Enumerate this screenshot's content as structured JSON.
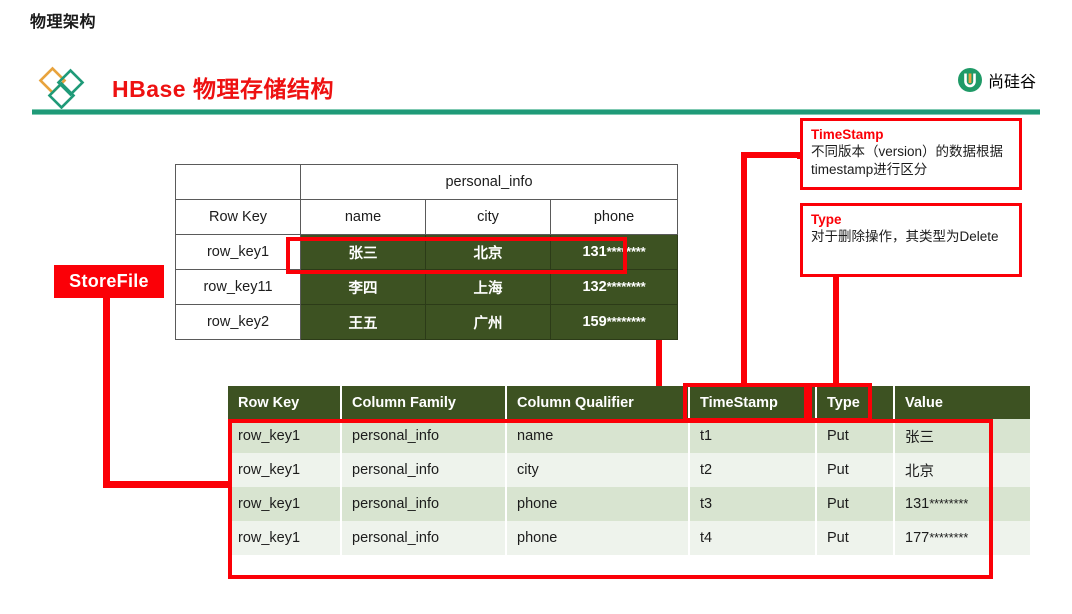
{
  "slide": {
    "title": "物理架构"
  },
  "header": {
    "title": "HBase 物理存储结构",
    "brand_text": "尚硅谷",
    "accent_red": "#ee1111",
    "accent_green": "#1f9a67",
    "rule_color": "#1f9a78"
  },
  "colors": {
    "table_header_green": "#3d5222",
    "row_light_green": "#d8e4d0",
    "row_pale_green": "#eef3ec",
    "highlight_red": "#fb0007"
  },
  "upper_table": {
    "column_family_label": "personal_info",
    "headers": [
      "Row Key",
      "name",
      "city",
      "phone"
    ],
    "rows": [
      {
        "row_key": "row_key1",
        "name": "张三",
        "city": "北京",
        "phone_prefix": "131",
        "phone_mask": "********"
      },
      {
        "row_key": "row_key11",
        "name": "李四",
        "city": "上海",
        "phone_prefix": "132",
        "phone_mask": "********"
      },
      {
        "row_key": "row_key2",
        "name": "王五",
        "city": "广州",
        "phone_prefix": "159",
        "phone_mask": "********"
      }
    ]
  },
  "store_file": {
    "label": "StoreFile"
  },
  "callouts": [
    {
      "title": "TimeStamp",
      "body": "不同版本（version）的数据根据timestamp进行区分"
    },
    {
      "title": "Type",
      "body": "对于删除操作，其类型为Delete"
    }
  ],
  "lower_table": {
    "headers": [
      "Row Key",
      "Column Family",
      "Column Qualifier",
      "TimeStamp",
      "Type",
      "Value"
    ],
    "rows": [
      {
        "row_key": "row_key1",
        "column_family": "personal_info",
        "column_qualifier": "name",
        "timestamp": "t1",
        "type": "Put",
        "value": "张三",
        "value_mask": ""
      },
      {
        "row_key": "row_key1",
        "column_family": "personal_info",
        "column_qualifier": "city",
        "timestamp": "t2",
        "type": "Put",
        "value": "北京",
        "value_mask": ""
      },
      {
        "row_key": "row_key1",
        "column_family": "personal_info",
        "column_qualifier": "phone",
        "timestamp": "t3",
        "type": "Put",
        "value": "131",
        "value_mask": "********"
      },
      {
        "row_key": "row_key1",
        "column_family": "personal_info",
        "column_qualifier": "phone",
        "timestamp": "t4",
        "type": "Put",
        "value": "177",
        "value_mask": "********"
      }
    ]
  }
}
